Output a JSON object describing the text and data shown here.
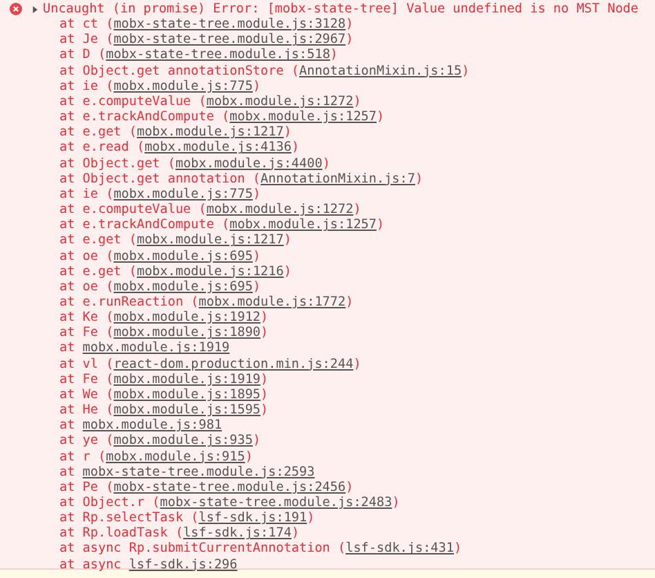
{
  "console_message": {
    "expanded": false,
    "message": "Uncaught (in promise) Error: [mobx-state-tree] Value undefined is no MST Node",
    "stack": [
      {
        "before": "at ct (",
        "location": "mobx-state-tree.module.js:3128",
        "after": ")"
      },
      {
        "before": "at Je (",
        "location": "mobx-state-tree.module.js:2967",
        "after": ")"
      },
      {
        "before": "at D (",
        "location": "mobx-state-tree.module.js:518",
        "after": ")"
      },
      {
        "before": "at Object.get annotationStore (",
        "location": "AnnotationMixin.js:15",
        "after": ")"
      },
      {
        "before": "at ie (",
        "location": "mobx.module.js:775",
        "after": ")"
      },
      {
        "before": "at e.computeValue (",
        "location": "mobx.module.js:1272",
        "after": ")"
      },
      {
        "before": "at e.trackAndCompute (",
        "location": "mobx.module.js:1257",
        "after": ")"
      },
      {
        "before": "at e.get (",
        "location": "mobx.module.js:1217",
        "after": ")"
      },
      {
        "before": "at e.read (",
        "location": "mobx.module.js:4136",
        "after": ")"
      },
      {
        "before": "at Object.get (",
        "location": "mobx.module.js:4400",
        "after": ")"
      },
      {
        "before": "at Object.get annotation (",
        "location": "AnnotationMixin.js:7",
        "after": ")"
      },
      {
        "before": "at ie (",
        "location": "mobx.module.js:775",
        "after": ")"
      },
      {
        "before": "at e.computeValue (",
        "location": "mobx.module.js:1272",
        "after": ")"
      },
      {
        "before": "at e.trackAndCompute (",
        "location": "mobx.module.js:1257",
        "after": ")"
      },
      {
        "before": "at e.get (",
        "location": "mobx.module.js:1217",
        "after": ")"
      },
      {
        "before": "at oe (",
        "location": "mobx.module.js:695",
        "after": ")"
      },
      {
        "before": "at e.get (",
        "location": "mobx.module.js:1216",
        "after": ")"
      },
      {
        "before": "at oe (",
        "location": "mobx.module.js:695",
        "after": ")"
      },
      {
        "before": "at e.runReaction (",
        "location": "mobx.module.js:1772",
        "after": ")"
      },
      {
        "before": "at Ke (",
        "location": "mobx.module.js:1912",
        "after": ")"
      },
      {
        "before": "at Fe (",
        "location": "mobx.module.js:1890",
        "after": ")"
      },
      {
        "before": "at ",
        "location": "mobx.module.js:1919"
      },
      {
        "before": "at vl (",
        "location": "react-dom.production.min.js:244",
        "after": ")"
      },
      {
        "before": "at Fe (",
        "location": "mobx.module.js:1919",
        "after": ")"
      },
      {
        "before": "at We (",
        "location": "mobx.module.js:1895",
        "after": ")"
      },
      {
        "before": "at He (",
        "location": "mobx.module.js:1595",
        "after": ")"
      },
      {
        "before": "at ",
        "location": "mobx.module.js:981"
      },
      {
        "before": "at ye (",
        "location": "mobx.module.js:935",
        "after": ")"
      },
      {
        "before": "at r (",
        "location": "mobx.module.js:915",
        "after": ")"
      },
      {
        "before": "at ",
        "location": "mobx-state-tree.module.js:2593"
      },
      {
        "before": "at Pe (",
        "location": "mobx-state-tree.module.js:2456",
        "after": ")"
      },
      {
        "before": "at Object.r (",
        "location": "mobx-state-tree.module.js:2483",
        "after": ")"
      },
      {
        "before": "at Rp.selectTask (",
        "location": "lsf-sdk.js:191",
        "after": ")"
      },
      {
        "before": "at Rp.loadTask (",
        "location": "lsf-sdk.js:174",
        "after": ")"
      },
      {
        "before": "at async Rp.submitCurrentAnnotation (",
        "location": "lsf-sdk.js:431",
        "after": ")"
      },
      {
        "before": "at async ",
        "location": "lsf-sdk.js:296"
      }
    ]
  }
}
